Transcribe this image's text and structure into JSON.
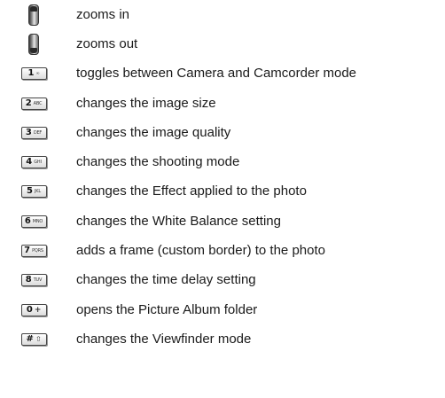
{
  "rows": [
    {
      "icon": "volume-up-key-icon",
      "key": "",
      "sub": "",
      "text": "zooms in"
    },
    {
      "icon": "volume-down-key-icon",
      "key": "",
      "sub": "",
      "text": "zooms out"
    },
    {
      "icon": "key-1-icon",
      "key": "1",
      "sub": "∞",
      "text": "toggles between Camera and Camcorder mode"
    },
    {
      "icon": "key-2-icon",
      "key": "2",
      "sub": "ABC",
      "text": "changes the image size"
    },
    {
      "icon": "key-3-icon",
      "key": "3",
      "sub": "DEF",
      "text": "changes the image quality"
    },
    {
      "icon": "key-4-icon",
      "key": "4",
      "sub": "GHI",
      "text": "changes the shooting mode"
    },
    {
      "icon": "key-5-icon",
      "key": "5",
      "sub": "JKL",
      "text": "changes the Effect applied to the photo"
    },
    {
      "icon": "key-6-icon",
      "key": "6",
      "sub": "MNO",
      "text": "changes the White Balance setting"
    },
    {
      "icon": "key-7-icon",
      "key": "7",
      "sub": "PQRS",
      "text": "adds a frame (custom border) to the photo"
    },
    {
      "icon": "key-8-icon",
      "key": "8",
      "sub": "TUV",
      "text": "changes the time delay setting"
    },
    {
      "icon": "key-0-icon",
      "key": "0",
      "sub": "+",
      "text": "opens the Picture Album folder"
    },
    {
      "icon": "key-hash-icon",
      "key": "#",
      "sub": "⇧",
      "text": "changes the Viewfinder mode"
    }
  ]
}
